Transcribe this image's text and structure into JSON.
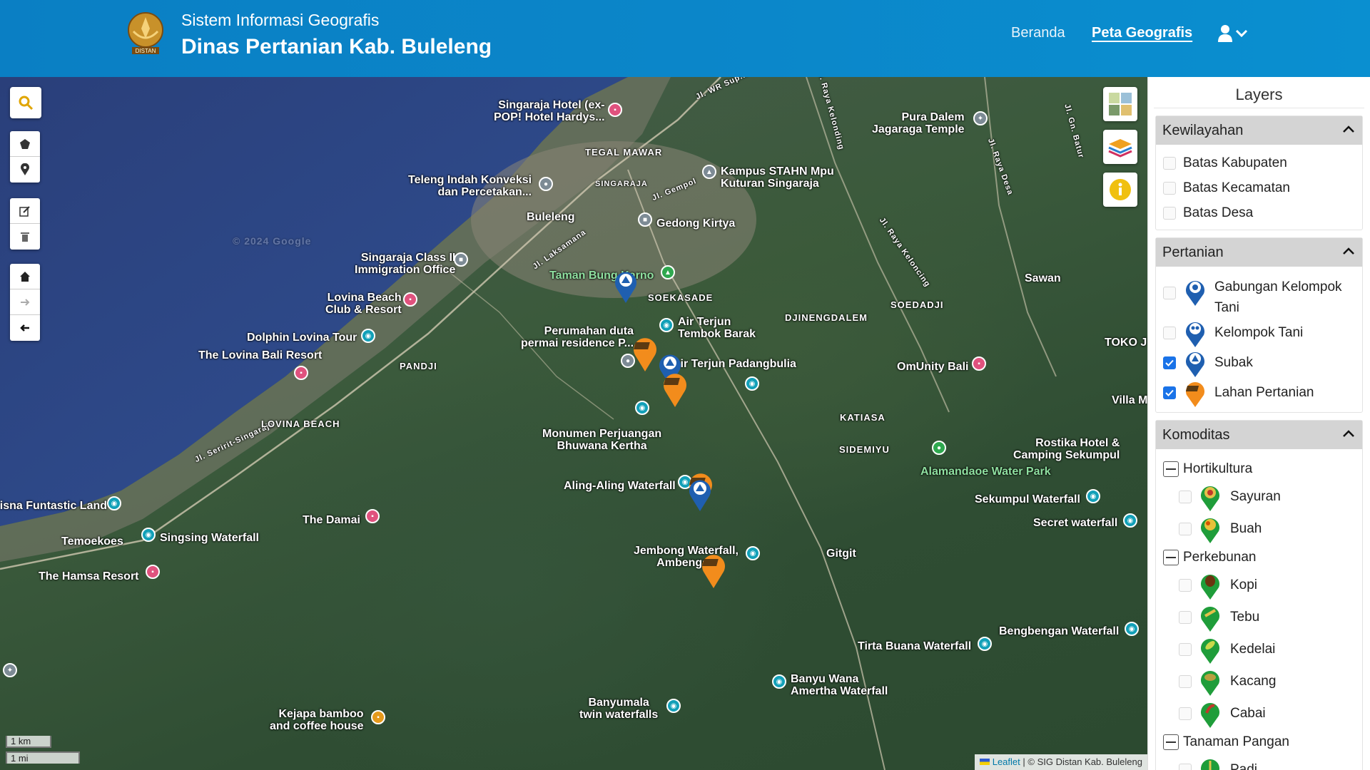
{
  "header": {
    "subtitle": "Sistem Informasi Geografis",
    "title": "Dinas Pertanian Kab. Buleleng",
    "logo_text": "DISTAN",
    "nav": {
      "home": "Beranda",
      "map": "Peta Geografis"
    }
  },
  "map": {
    "places": [
      {
        "text": "Singaraja Hotel (ex-",
        "text2": "POP! Hotel Hardys..."
      },
      {
        "text": "Pura Dalem",
        "text2": "Jagaraga Temple"
      },
      {
        "text": "Kampus STAHN Mpu",
        "text2": "Kuturan Singaraja"
      },
      {
        "text": "Teleng Indah Konveksi",
        "text2": "dan Percetakan..."
      },
      {
        "text": "Buleleng"
      },
      {
        "text": "Gedong Kirtya"
      },
      {
        "text": "Singaraja Class II",
        "text2": "Immigration Office"
      },
      {
        "text": "Lovina Beach",
        "text2": "Club & Resort"
      },
      {
        "text": "Taman Bung Karno"
      },
      {
        "text": "Air Terjun",
        "text2": "Tembok Barak"
      },
      {
        "text": "Perumahan duta",
        "text2": "permai residence P..."
      },
      {
        "text": "Dolphin Lovina Tour"
      },
      {
        "text": "The Lovina Bali Resort"
      },
      {
        "text": "Air Terjun Padangbulia"
      },
      {
        "text": "OmUnity Bali"
      },
      {
        "text": "Villa M"
      },
      {
        "text": "TOKO J"
      },
      {
        "text": "Sawan"
      },
      {
        "text": "Monumen Perjuangan",
        "text2": "Bhuwana Kertha"
      },
      {
        "text": "Rostika Hotel &",
        "text2": "Camping Sekumpul"
      },
      {
        "text": "Alamandaoe Water Park"
      },
      {
        "text": "Aling-Aling Waterfall"
      },
      {
        "text": "Sekumpul Waterfall"
      },
      {
        "text": "Secret waterfall"
      },
      {
        "text": "Krisna Funtastic Land"
      },
      {
        "text": "The Damai"
      },
      {
        "text": "Temoekoes"
      },
      {
        "text": "Singsing Waterfall"
      },
      {
        "text": "Jembong Waterfall,",
        "text2": "Ambengan"
      },
      {
        "text": "Gitgit"
      },
      {
        "text": "The Hamsa Resort"
      },
      {
        "text": "Bengbengan Waterfall"
      },
      {
        "text": "Tirta Buana Waterfall"
      },
      {
        "text": "Banyu Wana",
        "text2": "Amertha Waterfall"
      },
      {
        "text": "Banyumala",
        "text2": "twin waterfalls"
      },
      {
        "text": "Kejapa bamboo",
        "text2": "and coffee house"
      }
    ],
    "areas": [
      "TEGAL MAWAR",
      "SINGARAJA",
      "SOEKASADE",
      "DJINENGDALEM",
      "SOEDADJI",
      "PANDJI",
      "KATIASA",
      "LOVINA BEACH",
      "SIDEMIYU"
    ],
    "roads": [
      "Jl. WR Sup...",
      "Jl. Gempol",
      "Jl. Laksamana",
      "Jl. Seririt-Singaraja",
      "Jl. Raya Kelonding",
      "Jl. Raya Desa",
      "Jl. Gn. Batur",
      "Jl. Raya Keloncing"
    ],
    "scale": {
      "km": "1 km",
      "mi": "1 mi"
    },
    "attribution": {
      "leaflet": "Leaflet",
      "rest": "| © SIG Distan Kab. Buleleng"
    },
    "watermark": "© 2024 Google"
  },
  "panel": {
    "title": "Layers",
    "sections": [
      {
        "name": "Kewilayahan",
        "items": [
          {
            "label": "Batas Kabupaten",
            "checked": false
          },
          {
            "label": "Batas Kecamatan",
            "checked": false
          },
          {
            "label": "Batas Desa",
            "checked": false
          }
        ]
      },
      {
        "name": "Pertanian",
        "items": [
          {
            "label": "Gabungan Kelompok",
            "label2": "Tani",
            "checked": false,
            "icon": "gapoktan-marker-icon"
          },
          {
            "label": "Kelompok Tani",
            "checked": false,
            "icon": "kelompok-tani-marker-icon"
          },
          {
            "label": "Subak",
            "checked": true,
            "icon": "subak-marker-icon"
          },
          {
            "label": "Lahan Pertanian",
            "checked": true,
            "icon": "lahan-pertanian-marker-icon"
          }
        ]
      },
      {
        "name": "Komoditas",
        "groups": [
          {
            "name": "Hortikultura",
            "items": [
              "Sayuran",
              "Buah"
            ]
          },
          {
            "name": "Perkebunan",
            "items": [
              "Kopi",
              "Tebu",
              "Kedelai",
              "Kacang",
              "Cabai"
            ]
          },
          {
            "name": "Tanaman Pangan",
            "items": [
              "Padi"
            ]
          }
        ]
      }
    ]
  },
  "colors": {
    "header": "#0a86c9",
    "subak_marker": "#1f5fb0",
    "lahan_marker": "#f28c1c",
    "komoditas_marker": "#1f9d3a",
    "checkbox_on": "#1a73e8"
  }
}
